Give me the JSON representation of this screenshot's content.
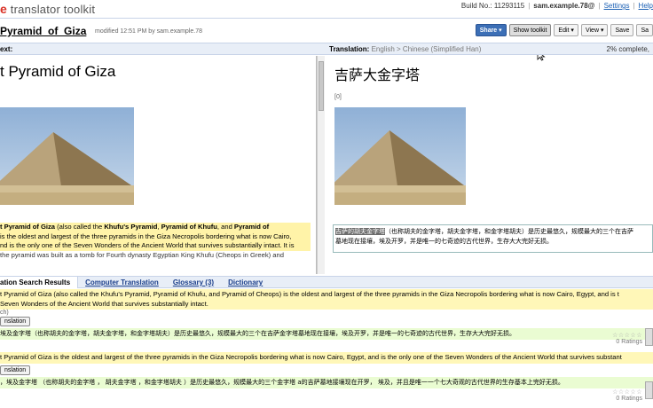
{
  "app": {
    "logo_g": "e",
    "title": "translator toolkit"
  },
  "userbar": {
    "build": "Build No.: 11293115",
    "user": "sam.example.78@",
    "settings": "Settings",
    "help": "Help"
  },
  "doc": {
    "title": "Pyramid_of_Giza",
    "meta": "modified 12:51 PM by sam.example.78"
  },
  "toolbar": {
    "share": "Share ▾",
    "show_toolkit": "Show toolkit",
    "edit": "Edit ▾",
    "view": "View ▾",
    "save": "Save",
    "save_short": "Sa"
  },
  "panes": {
    "source_header": "ext:",
    "translation_label": "Translation:",
    "translation_langs": "English > Chinese (Simplified Han)",
    "complete": "2% complete,"
  },
  "source": {
    "title": "t Pyramid of Giza",
    "para_intro": "t Pyramid of Giza",
    "para_also": " (also called the ",
    "para_khufus": "Khufu's Pyramid",
    "para_comma1": ", ",
    "para_pyr_khufu": "Pyramid of Khufu",
    "para_and": ", and ",
    "para_pyr_of": "Pyramid of",
    "line2": " is the oldest and largest of the three pyramids in the Giza Necropolis bordering what is now Cairo,",
    "line3": "nd is the only one of the Seven Wonders of the Ancient World that survives substantially intact. It is",
    "line4": "the pyramid was built as a tomb for Fourth dynasty Egyptian King Khufu (Cheops in Greek) and",
    "line5": "                                                        "
  },
  "translation": {
    "title": "吉萨大金字塔",
    "num": "[0]",
    "box_sel": "吉萨的胡夫金字塔",
    "box_line1": "（也称胡夫的金字塔，胡夫金字塔，和金字塔胡夫）是历史最悠久，规模最大的三个在吉萨",
    "box_line2": "墓地现在接壤，埃及开罗，并是唯一的七奇迹的古代世界，生存大大完好无损。"
  },
  "tabs": [
    {
      "label": "ation Search Results"
    },
    {
      "label": "Computer Translation"
    },
    {
      "label": "Glossary (3)"
    },
    {
      "label": "Dictionary"
    }
  ],
  "results": {
    "src1_line1": "t Pyramid of Giza (also called the Khufu's Pyramid, Pyramid of Khufu, and Pyramid of Cheops) is the oldest and largest of the three pyramids in the Giza Necropolis bordering what is now Cairo, Egypt, and is t",
    "src1_line2": "Seven Wonders of the Ancient World that survives substantially intact.",
    "meta1": "ch)",
    "use1": "nslation",
    "trans1": "埃及金字塔（也称胡夫的金字塔，胡夫金字塔，和金字塔胡夫）是历史最悠久，规模最大的三个在吉萨金字塔墓地现在接壤，埃及开罗，并是唯一的七奇迹的古代世界，生存大大完好无损。",
    "rating1_stars": "☆☆☆☆☆",
    "rating1_count": "0 Ratings",
    "src2": "t Pyramid of Giza is the oldest and largest of the three pyramids in the Giza Necropolis bordering what is now Cairo, Egypt, and is the only one of the Seven Wonders of the Ancient World that survives substant",
    "use2": "nslation",
    "trans2": "，埃及金字塔 （也称胡夫的金字塔 ， 胡夫金字塔 ，和金字塔胡夫 ）是历史最悠久，规模最大的三个金字塔 a的吉萨墓地接壤现在开罗， 埃及，并且是唯一一个七大奇观的古代世界的生存基本上完好无损。",
    "rating2_stars": "☆☆☆☆☆",
    "rating2_count": "0 Ratings"
  },
  "colors": {
    "share_blue": "#3c6fb6",
    "source_highlight": "#fff3a8",
    "tm_green": "#eafcd2",
    "pane_header": "#e8eef7"
  }
}
